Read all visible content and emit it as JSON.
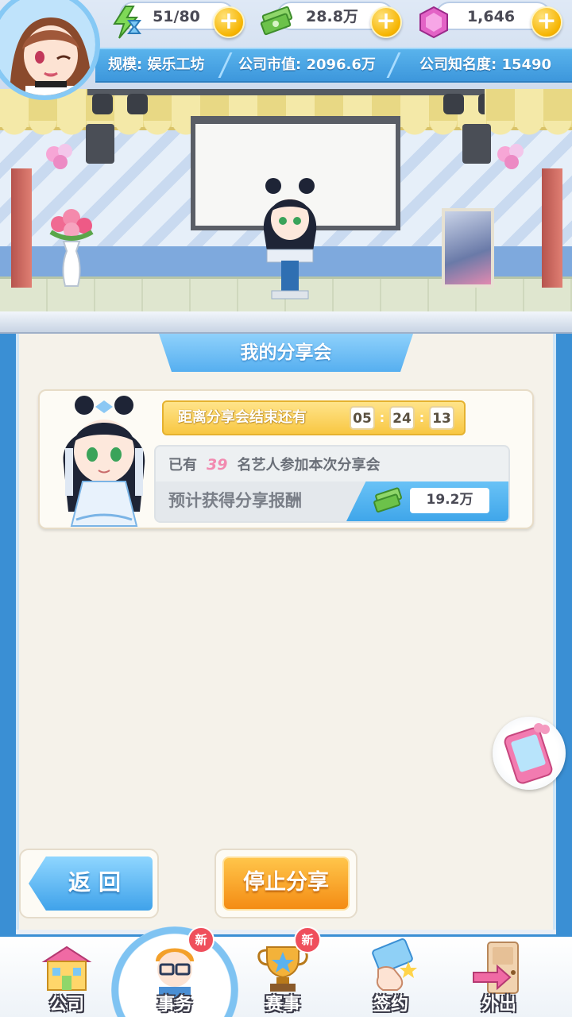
{
  "resources": {
    "energy": {
      "value": "51/80",
      "icon": "lightning-hourglass-icon"
    },
    "money": {
      "value": "28.8万",
      "icon": "cash-stack-icon"
    },
    "gems": {
      "value": "1,646",
      "icon": "pink-gem-icon"
    },
    "plus_label": "+"
  },
  "company": {
    "scale": "规模: 娱乐工坊",
    "market_value": "公司市值: 2096.6万",
    "fame": "公司知名度: 15490"
  },
  "panel": {
    "title": "我的分享会",
    "countdown_label": "距离分享会结束还有",
    "time": {
      "hours": "05",
      "minutes": "24",
      "seconds": "13",
      "separator": ":"
    },
    "attend_prefix": "已有",
    "attend_count": "39",
    "attend_suffix": "名艺人参加本次分享会",
    "reward_label": "预计获得分享报酬",
    "reward_value": "19.2万"
  },
  "buttons": {
    "back": "返回",
    "stop": "停止分享"
  },
  "nav": {
    "items": [
      {
        "label": "公司",
        "icon": "company-building-icon",
        "badge": ""
      },
      {
        "label": "事务",
        "icon": "manager-glasses-icon",
        "badge": "新"
      },
      {
        "label": "赛事",
        "icon": "trophy-star-icon",
        "badge": "新"
      },
      {
        "label": "签约",
        "icon": "contract-hand-icon",
        "badge": ""
      },
      {
        "label": "外出",
        "icon": "door-exit-icon",
        "badge": ""
      }
    ],
    "active": "事务"
  },
  "colors": {
    "accent_blue": "#3d97dc",
    "gold": "#f6b400",
    "orange": "#f48c14",
    "badge_red": "#ef4f5c",
    "attend_pink": "#f28ab0"
  }
}
